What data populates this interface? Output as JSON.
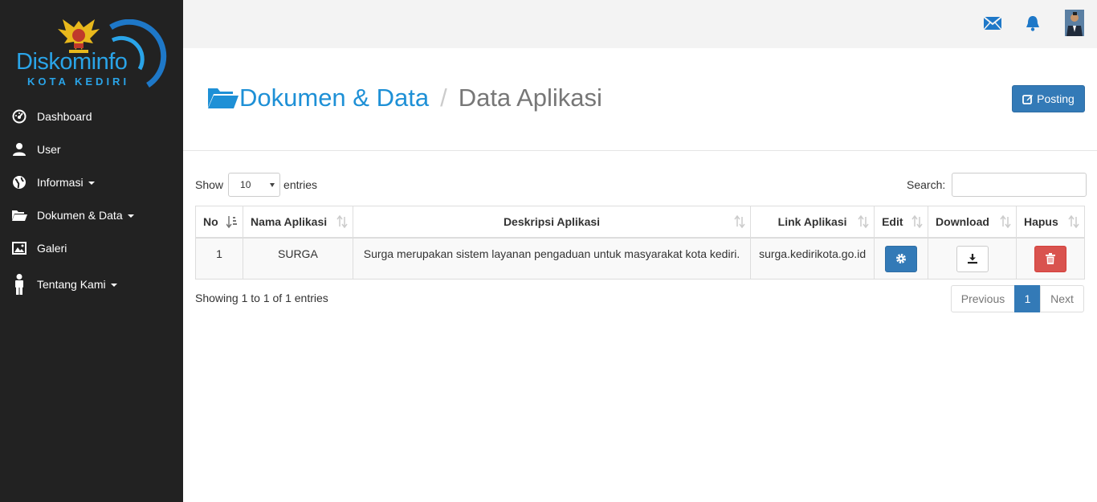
{
  "brand": {
    "name": "Diskominfo",
    "city": "KOTA KEDIRI"
  },
  "sidebar": {
    "items": [
      {
        "label": "Dashboard",
        "icon": "dashboard-icon"
      },
      {
        "label": "User",
        "icon": "user-icon"
      },
      {
        "label": "Informasi",
        "icon": "globe-icon",
        "dropdown": true
      },
      {
        "label": "Dokumen & Data",
        "icon": "folder-open-icon",
        "dropdown": true
      },
      {
        "label": "Galeri",
        "icon": "picture-icon"
      },
      {
        "label": "Tentang Kami",
        "icon": "person-icon",
        "dropdown": true
      }
    ]
  },
  "topbar": {
    "icons": [
      "envelope-icon",
      "bell-icon",
      "avatar"
    ]
  },
  "header": {
    "crumb_parent": "Dokumen & Data",
    "crumb_separator": "/",
    "crumb_active": "Data Aplikasi",
    "posting_label": "Posting"
  },
  "table_controls": {
    "show_label": "Show",
    "entries_label": "entries",
    "length_value": "10",
    "search_label": "Search:",
    "search_value": ""
  },
  "table": {
    "columns": [
      "No",
      "Nama Aplikasi",
      "Deskripsi Aplikasi",
      "Link Aplikasi",
      "Edit",
      "Download",
      "Hapus"
    ],
    "rows": [
      {
        "no": "1",
        "nama": "SURGA",
        "deskripsi": "Surga merupakan sistem layanan pengaduan untuk masyarakat kota kediri.",
        "link": "surga.kedirikota.go.id"
      }
    ]
  },
  "footer": {
    "info": "Showing 1 to 1 of 1 entries",
    "prev_label": "Previous",
    "page_label": "1",
    "next_label": "Next"
  },
  "colors": {
    "sidebar_bg": "#222222",
    "accent": "#337ab7",
    "link": "#1e90d6",
    "danger": "#d9534f"
  }
}
